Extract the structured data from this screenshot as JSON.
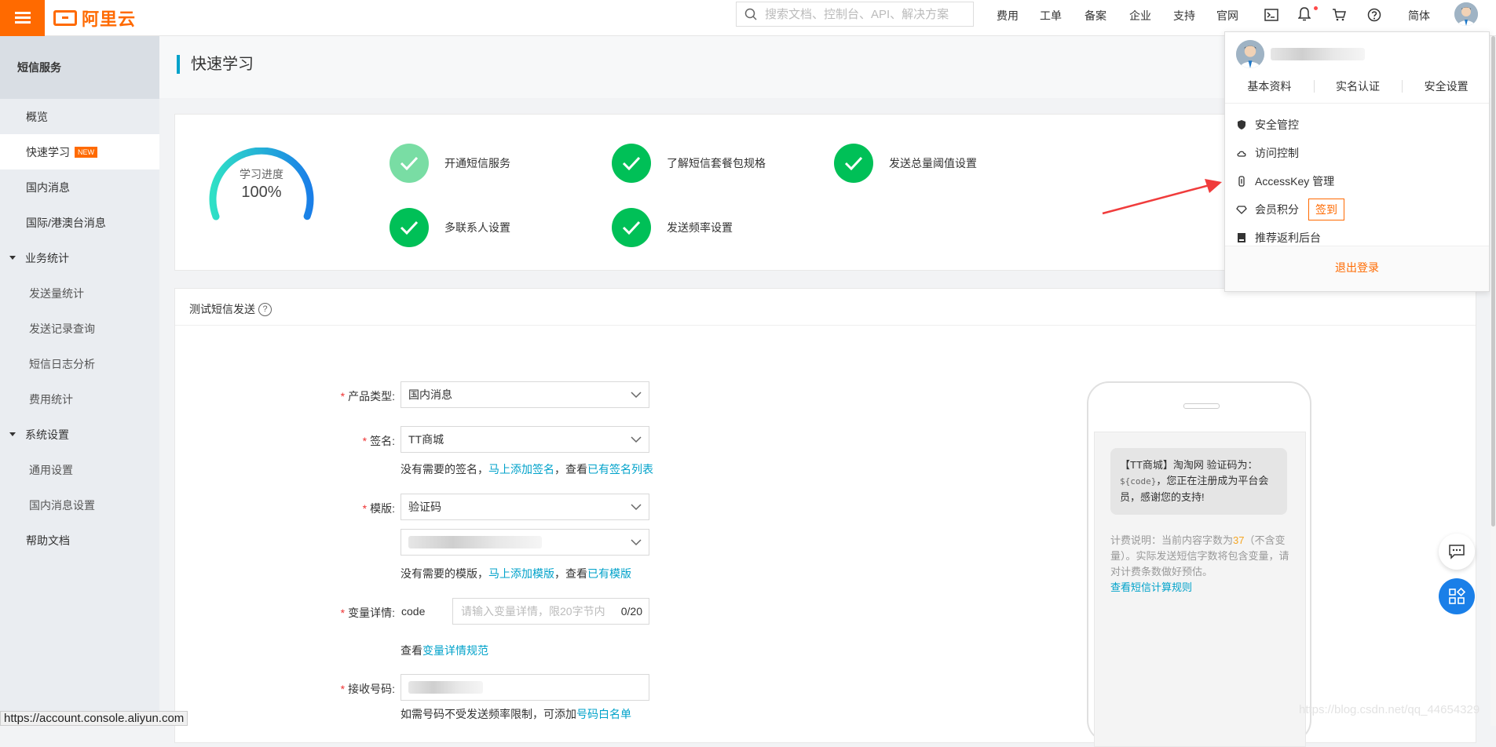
{
  "topbar": {
    "logo_text": "阿里云",
    "search_placeholder": "搜索文档、控制台、API、解决方案",
    "nav": [
      "费用",
      "工单",
      "备案",
      "企业",
      "支持",
      "官网"
    ],
    "lang": "简体",
    "accent": "#ff6a00"
  },
  "sidebar": {
    "title": "短信服务",
    "items": [
      {
        "label": "概览"
      },
      {
        "label": "快速学习",
        "tag": "NEW"
      },
      {
        "label": "国内消息"
      },
      {
        "label": "国际/港澳台消息"
      }
    ],
    "group_stats": {
      "label": "业务统计",
      "children": [
        "发送量统计",
        "发送记录查询",
        "短信日志分析",
        "费用统计"
      ]
    },
    "group_settings": {
      "label": "系统设置",
      "children": [
        "通用设置",
        "国内消息设置"
      ]
    },
    "help": "帮助文档"
  },
  "page": {
    "title": "快速学习",
    "progress_label": "学习进度",
    "progress_value": "100%",
    "progress_fraction": 1.0,
    "steps": [
      "开通短信服务",
      "了解短信套餐包规格",
      "发送总量阈值设置",
      "多联系人设置",
      "发送频率设置"
    ],
    "success_color": "#00c057"
  },
  "test": {
    "section_title": "测试短信发送",
    "help_glyph": "?",
    "product_label": "产品类型:",
    "product_value": "国内消息",
    "sign_label": "签名:",
    "sign_value": "TT商城",
    "sign_hint_prefix": "没有需要的签名，",
    "sign_hint_link1": "马上添加签名",
    "sign_hint_mid": "，查看",
    "sign_hint_link2": "已有签名列表",
    "template_label": "模版:",
    "template_value": "验证码",
    "template_hint_prefix": "没有需要的模版，",
    "template_hint_link1": "马上添加模版",
    "template_hint_mid": "，查看",
    "template_hint_link2": "已有模版",
    "var_label": "变量详情:",
    "var_name": "code",
    "var_placeholder": "请输入变量详情，限20字节内",
    "var_count": "0/20",
    "var_hint_prefix": "查看",
    "var_hint_link": "变量详情规范",
    "phone_label": "接收号码:",
    "phone_hint_prefix": "如需号码不受发送频率限制，可添加",
    "phone_hint_link": "号码白名单"
  },
  "preview": {
    "msg_prefix": "【TT商城】淘淘网  验证码为：",
    "msg_code": "${code}",
    "msg_suffix": "，您正在注册成为平台会员，感谢您的支持!",
    "fee_prefix": "计费说明：当前内容字数为",
    "fee_count": "37",
    "fee_suffix": "（不含变量）。实际发送短信字数将包含变量，请对计费条数做好预估。",
    "fee_link": "查看短信计算规则"
  },
  "account_menu": {
    "links": [
      "基本资料",
      "实名认证",
      "安全设置"
    ],
    "items": [
      "安全管控",
      "访问控制",
      "AccessKey 管理",
      "会员积分",
      "推荐返利后台"
    ],
    "sign_in": "签到",
    "logout": "退出登录"
  },
  "status_bar": {
    "url": "https://account.console.aliyun.com"
  },
  "watermark": "https://blog.csdn.net/qq_44654329"
}
